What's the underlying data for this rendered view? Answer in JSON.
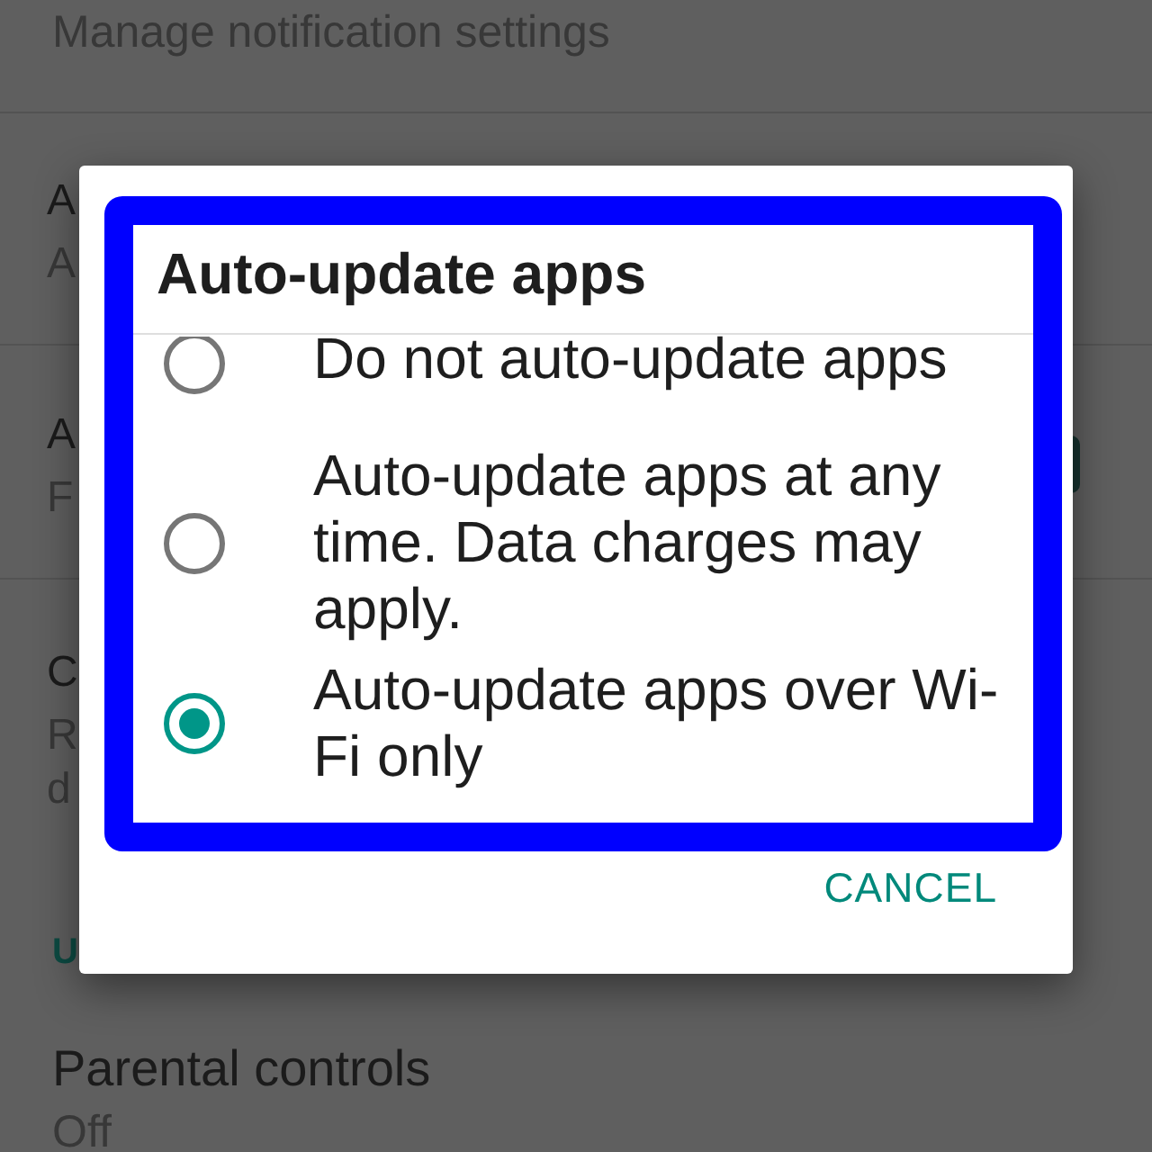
{
  "settings_above": [
    {
      "kind": "text",
      "subtitle_lines": [
        "Manage notification settings"
      ]
    },
    {
      "kind": "text",
      "title": "A",
      "subtitle_lines": [
        "A"
      ]
    },
    {
      "kind": "switch",
      "title": "A",
      "subtitle_lines": [
        "F"
      ],
      "on": true
    },
    {
      "kind": "text",
      "title": "C",
      "subtitle_lines": [
        "R",
        "d"
      ]
    }
  ],
  "section_header": "U",
  "settings_below": [
    {
      "kind": "text",
      "title": "Parental controls",
      "subtitle_lines": [
        "Off"
      ]
    }
  ],
  "dialog": {
    "title": "Auto-update apps",
    "options": [
      {
        "label": "Do not auto-update apps",
        "selected": false
      },
      {
        "label": "Auto-update apps at any time. Data charges may apply.",
        "selected": false
      },
      {
        "label": "Auto-update apps over Wi-Fi only",
        "selected": true
      }
    ],
    "buttons": [
      "CANCEL"
    ]
  }
}
